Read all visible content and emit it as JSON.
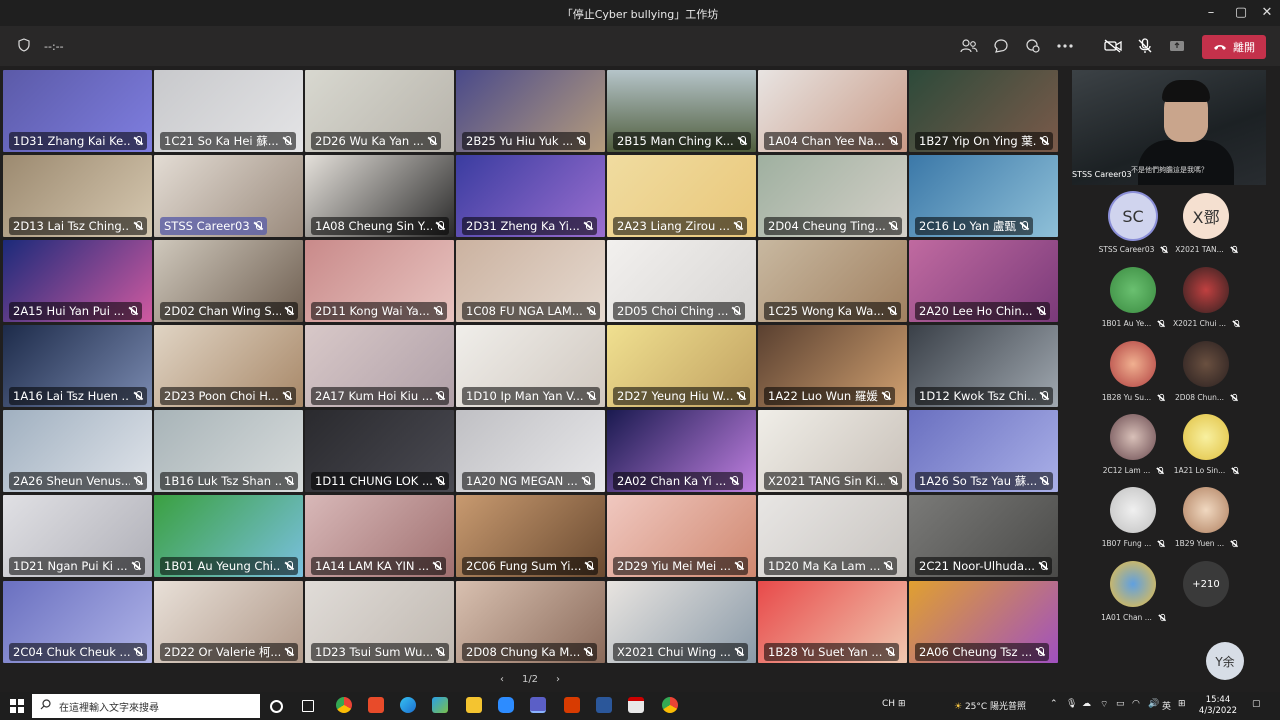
{
  "window": {
    "title": "「停止Cyber bullying」工作坊"
  },
  "toolbar": {
    "timer": "--:--",
    "leave_label": "離開"
  },
  "tiles": [
    {
      "name": "1D31 Zhang Kai Ke...",
      "bg": "linear-gradient(135deg,#5b5aa8,#7f7ee0)"
    },
    {
      "name": "1C21 So Ka Hei 蘇...",
      "bg": "linear-gradient(135deg,#c8c9cc,#e4e4e6)"
    },
    {
      "name": "2D26 Wu Ka Yan ...",
      "bg": "linear-gradient(135deg,#d8d8d0,#b7b3aa)"
    },
    {
      "name": "2B25 Yu Hiu Yuk ...",
      "bg": "linear-gradient(135deg,#4a4a8a,#b59c7d)"
    },
    {
      "name": "2B15 Man Ching K...",
      "bg": "linear-gradient(180deg,#b5c4c9,#4f5d3c)"
    },
    {
      "name": "1A04 Chan Yee Na...",
      "bg": "linear-gradient(135deg,#e8e4e2,#c99a86)"
    },
    {
      "name": "1B27 Yip On Ying 葉...",
      "bg": "linear-gradient(135deg,#2d4a3a,#7b5a4a)"
    },
    {
      "name": "2D13 Lai Tsz Ching...",
      "bg": "linear-gradient(135deg,#9c8a70,#d6c8b0)"
    },
    {
      "name": "STSS Career03",
      "bg": "linear-gradient(135deg,#e3dcd4,#9a8a7c)",
      "highlight": true
    },
    {
      "name": "1A08 Cheung Sin Y...",
      "bg": "linear-gradient(135deg,#e4e0da,#2a2a2a)"
    },
    {
      "name": "2D31 Zheng Ka Yi...",
      "bg": "linear-gradient(135deg,#3a3ca0,#9b6fd0)"
    },
    {
      "name": "2A23 Liang Zirou ...",
      "bg": "linear-gradient(135deg,#f0dca0,#e9c77a)"
    },
    {
      "name": "2D04 Cheung Ting...",
      "bg": "linear-gradient(135deg,#9fb0a0,#d4d0c8)"
    },
    {
      "name": "2C16 Lo Yan 盧甄",
      "bg": "linear-gradient(135deg,#3b78a8,#8fc0d8)"
    },
    {
      "name": "2A15 Hui Yan Pui ...",
      "bg": "linear-gradient(135deg,#1b2a7a,#d05aa0)"
    },
    {
      "name": "2D02 Chan Wing S...",
      "bg": "linear-gradient(135deg,#cfc8bc,#6e5e50)"
    },
    {
      "name": "2D11 Kong Wai Ya...",
      "bg": "linear-gradient(135deg,#c98a8a,#e8c4c0)"
    },
    {
      "name": "1C08 FU NGA LAM...",
      "bg": "linear-gradient(135deg,#cbb2a0,#e6dad0)"
    },
    {
      "name": "2D05 Choi Ching ...",
      "bg": "linear-gradient(135deg,#f2f0ee,#d8d6d4)"
    },
    {
      "name": "1C25 Wong Ka Wa...",
      "bg": "linear-gradient(135deg,#c8b8a0,#a08060)"
    },
    {
      "name": "2A20 Lee Ho Chin...",
      "bg": "linear-gradient(135deg,#c06aa0,#7a3a7a)"
    },
    {
      "name": "1A16 Lai Tsz Huen ...",
      "bg": "linear-gradient(135deg,#1d2b4a,#7a8ab0)"
    },
    {
      "name": "2D23 Poon Choi H...",
      "bg": "linear-gradient(135deg,#e0d4c4,#a88868)"
    },
    {
      "name": "2A17 Kum Hoi Kiu ...",
      "bg": "linear-gradient(135deg,#d8c8c8,#b0a0a8)"
    },
    {
      "name": "1D10 Ip Man Yan V...",
      "bg": "linear-gradient(135deg,#f0eeea,#d0c8c0)"
    },
    {
      "name": "2D27 Yeung Hiu W...",
      "bg": "linear-gradient(135deg,#f0e090,#c0a060)"
    },
    {
      "name": "1A22 Luo Wun 羅媛",
      "bg": "linear-gradient(135deg,#5a4030,#d0a070)"
    },
    {
      "name": "1D12 Kwok Tsz Chi...",
      "bg": "linear-gradient(135deg,#3a4048,#a0a8b0)"
    },
    {
      "name": "2A26 Sheun Venus...",
      "bg": "linear-gradient(135deg,#a0b0c0,#e0e4ea)"
    },
    {
      "name": "1B16 Luk Tsz Shan ...",
      "bg": "linear-gradient(135deg,#a8b4b8,#d8dcdc)"
    },
    {
      "name": "1D11 CHUNG LOK ...",
      "bg": "linear-gradient(135deg,#2a2a2e,#4a4a52)"
    },
    {
      "name": "1A20 NG MEGAN ...",
      "bg": "linear-gradient(135deg,#c0c0c4,#e8e8ea)"
    },
    {
      "name": "2A02 Chan Ka Yi ...",
      "bg": "linear-gradient(135deg,#1a1a50,#c080e0)"
    },
    {
      "name": "X2021 TANG Sin Ki...",
      "bg": "linear-gradient(135deg,#f0eee8,#c8c0b8)"
    },
    {
      "name": "1A26 So Tsz Yau 蘇...",
      "bg": "linear-gradient(135deg,#6a70c0,#aab0e8)"
    },
    {
      "name": "1D21 Ngan Pui Ki ...",
      "bg": "linear-gradient(135deg,#e0e0e4,#b0b0b8)"
    },
    {
      "name": "1B01 Au Yeung Chi...",
      "bg": "linear-gradient(135deg,#3aa040,#7ac0e0)"
    },
    {
      "name": "1A14 LAM KA YIN ...",
      "bg": "linear-gradient(135deg,#d8b8b8,#a07070)"
    },
    {
      "name": "2C06 Fung Sum Yi...",
      "bg": "linear-gradient(135deg,#c89a70,#6a4a30)"
    },
    {
      "name": "2D29 Yiu Mei Mei ...",
      "bg": "linear-gradient(135deg,#f0c8c0,#d08870)"
    },
    {
      "name": "1D20 Ma Ka Lam ...",
      "bg": "linear-gradient(135deg,#e8e6e4,#c8c4c0)"
    },
    {
      "name": "2C21 Noor-Ulhuda...",
      "bg": "linear-gradient(135deg,#7a7a78,#4a4a48)"
    },
    {
      "name": "2C04 Chuk Cheuk ...",
      "bg": "linear-gradient(135deg,#6a70c0,#b0b4e8)"
    },
    {
      "name": "2D22 Or Valerie 柯...",
      "bg": "linear-gradient(135deg,#e8e0d8,#b09888)"
    },
    {
      "name": "1D23 Tsui Sum Wu...",
      "bg": "linear-gradient(135deg,#e0dcd8,#c0b8b0)"
    },
    {
      "name": "2D08 Chung Ka M...",
      "bg": "linear-gradient(135deg,#d8c0b0,#8a6a5a)"
    },
    {
      "name": "X2021 Chui Wing ...",
      "bg": "linear-gradient(135deg,#e8e4e0,#8a9aa8)"
    },
    {
      "name": "1B28 Yu Suet Yan ...",
      "bg": "linear-gradient(135deg,#e84a4a,#f0c8b0)"
    },
    {
      "name": "2A06 Cheung Tsz ...",
      "bg": "linear-gradient(135deg,#e0a030,#a050c0)"
    }
  ],
  "pager": {
    "label": "1/2",
    "prev": "‹",
    "next": "›"
  },
  "featured": {
    "name": "STSS Career03",
    "caption": "不是他們夠膽這是我嗎？"
  },
  "attendees": [
    {
      "initials": "SC",
      "label": "STSS Career03",
      "bg": "#d0d4ee",
      "ring": true
    },
    {
      "initials": "X鄧",
      "label": "X2021 TAN...",
      "bg": "#f5e0d0"
    },
    {
      "initials": "",
      "label": "1B01 Au Ye...",
      "bg": "radial-gradient(circle,#6ac070,#3a8a40)"
    },
    {
      "initials": "",
      "label": "X2021 Chui ...",
      "bg": "radial-gradient(circle,#c04040,#302020)"
    },
    {
      "initials": "",
      "label": "1B28 Yu Su...",
      "bg": "radial-gradient(circle,#f0b090,#b04040)"
    },
    {
      "initials": "",
      "label": "2D08 Chun...",
      "bg": "radial-gradient(circle,#6a5040,#2a2020)"
    },
    {
      "initials": "",
      "label": "2C12 Lam ...",
      "bg": "radial-gradient(circle,#d8c0b8,#6a4a50)"
    },
    {
      "initials": "",
      "label": "1A21 Lo Sin...",
      "bg": "radial-gradient(circle,#f8f0a0,#e0c040)"
    },
    {
      "initials": "",
      "label": "1B07 Fung ...",
      "bg": "radial-gradient(circle,#f0f0f0,#c0c0c0)"
    },
    {
      "initials": "",
      "label": "1B29 Yuen ...",
      "bg": "radial-gradient(circle,#f0d8c0,#b08060)"
    },
    {
      "initials": "",
      "label": "1A01 Chan ...",
      "bg": "radial-gradient(circle,#60a0e0,#f0c040)"
    },
    {
      "initials": "+210",
      "label": "",
      "bg": "#3a3a3a",
      "more": true
    }
  ],
  "self_avatar": "Y余",
  "taskbar": {
    "search_placeholder": "在這裡輸入文字來搜尋",
    "weather": "25°C 陽光普照",
    "ime_hint": "CH",
    "lang": "英",
    "time": "15:44",
    "date": "4/3/2022"
  }
}
